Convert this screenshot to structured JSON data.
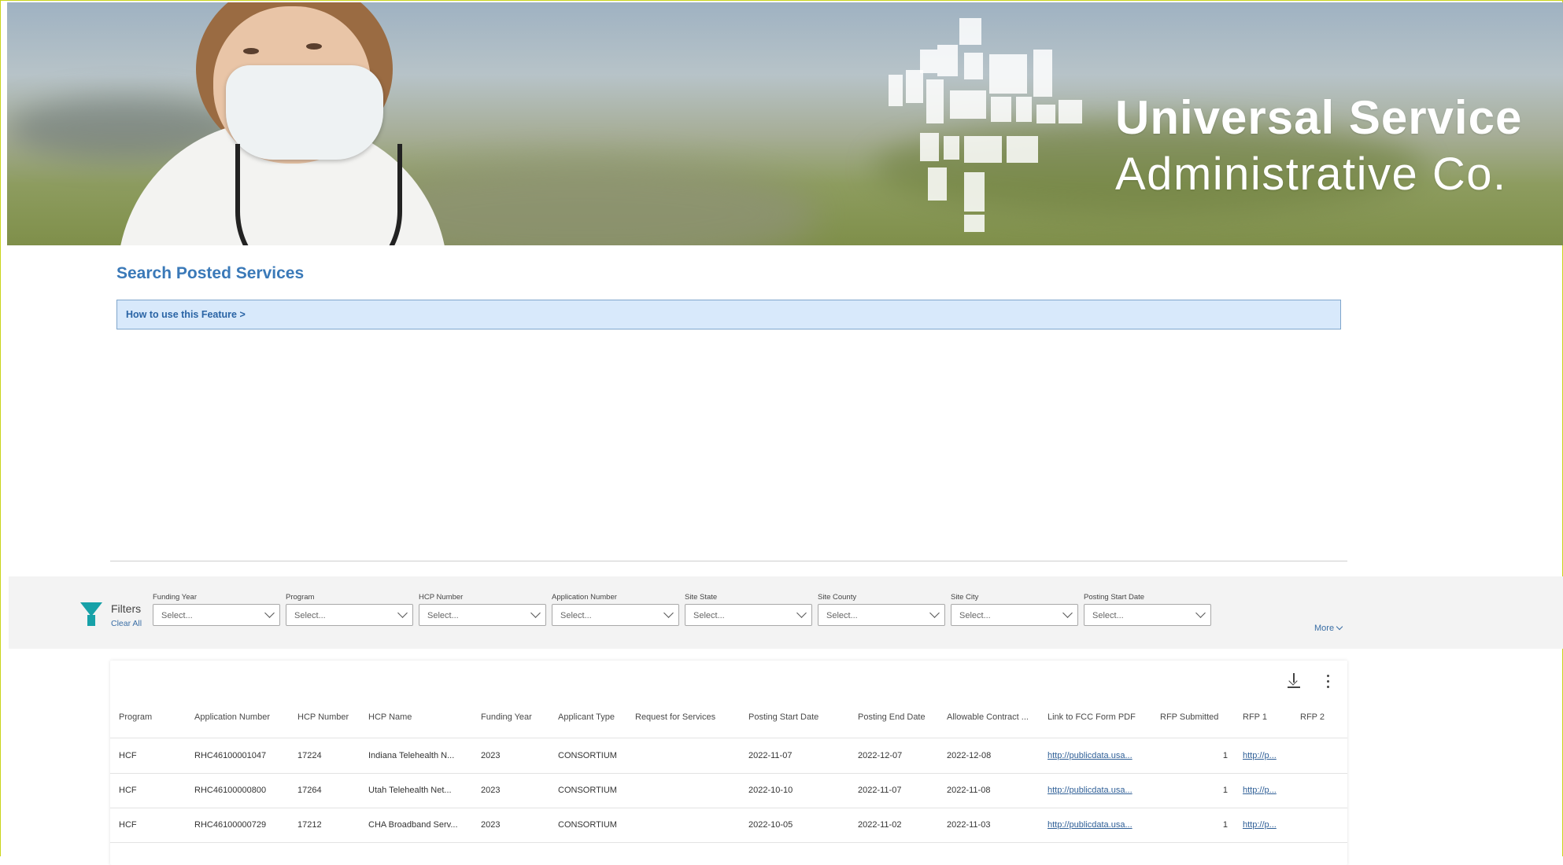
{
  "banner": {
    "logo_line1": "Universal Service",
    "logo_line2": "Administrative Co."
  },
  "page": {
    "title": "Search Posted Services",
    "howto": "How to use this Feature >"
  },
  "filters": {
    "label": "Filters",
    "clear_all": "Clear All",
    "more": "More",
    "fields": [
      {
        "label": "Funding Year",
        "placeholder": "Select..."
      },
      {
        "label": "Program",
        "placeholder": "Select..."
      },
      {
        "label": "HCP Number",
        "placeholder": "Select..."
      },
      {
        "label": "Application Number",
        "placeholder": "Select..."
      },
      {
        "label": "Site State",
        "placeholder": "Select..."
      },
      {
        "label": "Site County",
        "placeholder": "Select..."
      },
      {
        "label": "Site City",
        "placeholder": "Select..."
      },
      {
        "label": "Posting Start Date",
        "placeholder": "Select..."
      }
    ]
  },
  "table": {
    "columns": [
      "Program",
      "Application Number",
      "HCP Number",
      "HCP Name",
      "Funding Year",
      "Applicant Type",
      "Request for Services",
      "Posting Start Date",
      "Posting End Date",
      "Allowable Contract ...",
      "Link to FCC Form PDF",
      "RFP Submitted",
      "RFP 1",
      "RFP 2"
    ],
    "rows": [
      [
        "HCF",
        "RHC46100001047",
        "17224",
        "Indiana Telehealth N...",
        "2023",
        "CONSORTIUM",
        "",
        "2022-11-07",
        "2022-12-07",
        "2022-12-08",
        "http://publicdata.usa...",
        "1",
        "http://p...",
        ""
      ],
      [
        "HCF",
        "RHC46100000800",
        "17264",
        "Utah Telehealth Net...",
        "2023",
        "CONSORTIUM",
        "",
        "2022-10-10",
        "2022-11-07",
        "2022-11-08",
        "http://publicdata.usa...",
        "1",
        "http://p...",
        ""
      ],
      [
        "HCF",
        "RHC46100000729",
        "17212",
        "CHA Broadband Serv...",
        "2023",
        "CONSORTIUM",
        "",
        "2022-10-05",
        "2022-11-02",
        "2022-11-03",
        "http://publicdata.usa...",
        "1",
        "http://p...",
        ""
      ]
    ]
  },
  "icons": {
    "filter": "funnel-icon",
    "download": "download-icon",
    "more": "more-vertical-icon"
  },
  "colors": {
    "title_blue": "#3a79b8",
    "howto_bg": "#d8e9fb",
    "funnel_teal": "#17a1a8",
    "link_blue": "#2f5f97"
  }
}
